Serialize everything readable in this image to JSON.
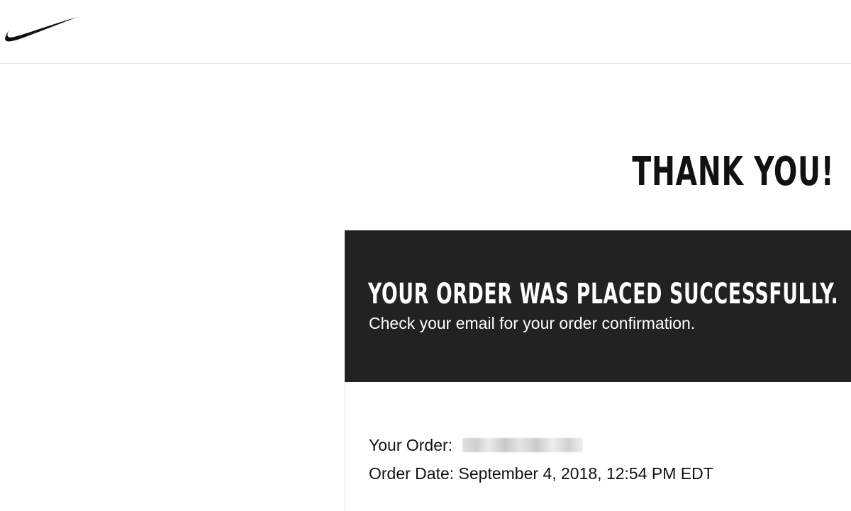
{
  "brand": {
    "logo_icon": "swoosh-logo-icon"
  },
  "main": {
    "thank_you_title": "THANK YOU!",
    "success_heading": "YOUR ORDER WAS PLACED SUCCESSFULLY.",
    "success_message": "Check your email for your order confirmation."
  },
  "order": {
    "order_label": "Your Order:",
    "date_label": "Order Date:",
    "date_value": "September 4, 2018, 12:54 PM EDT"
  },
  "colors": {
    "background": "#ffffff",
    "text": "#111111",
    "panel": "#222222",
    "panel_text": "#ffffff",
    "divider": "#e5e5e5"
  }
}
